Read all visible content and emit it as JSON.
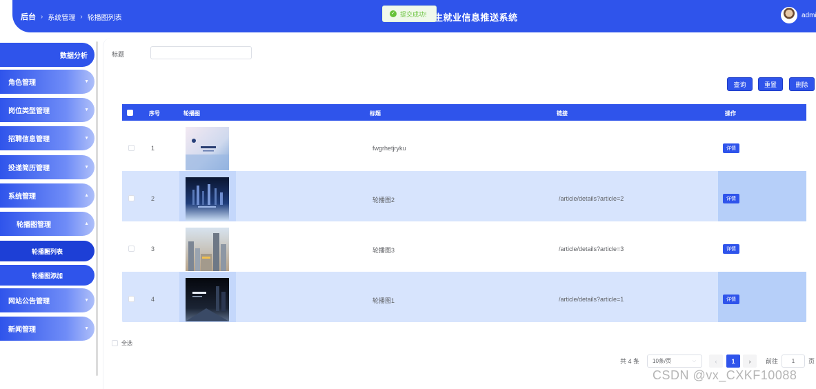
{
  "header": {
    "breadcrumb": [
      "后台",
      "系统管理",
      "轮播图列表"
    ],
    "system_title": "生就业信息推送系统",
    "user": "admi"
  },
  "toast": {
    "text": "提交成功!"
  },
  "sidebar": {
    "items": [
      {
        "label": "数据分析"
      },
      {
        "label": "角色管理"
      },
      {
        "label": "岗位类型管理"
      },
      {
        "label": "招聘信息管理"
      },
      {
        "label": "投递简历管理"
      },
      {
        "label": "系统管理"
      },
      {
        "label": "轮播图管理"
      },
      {
        "label": "轮播图列表"
      },
      {
        "label": "轮播图添加"
      },
      {
        "label": "网站公告管理"
      },
      {
        "label": "新闻管理"
      }
    ]
  },
  "filter": {
    "label": "标题"
  },
  "buttons": {
    "query": "查询",
    "reset": "重置",
    "delete": "删除"
  },
  "table": {
    "columns": [
      "序号",
      "轮播图",
      "标题",
      "链接",
      "操作"
    ],
    "rows": [
      {
        "index": "1",
        "title": "fwgrhetjryku",
        "link": "",
        "action": "详情"
      },
      {
        "index": "2",
        "title": "轮播图2",
        "link": "/article/details?article=2",
        "action": "详情"
      },
      {
        "index": "3",
        "title": "轮播图3",
        "link": "/article/details?article=3",
        "action": "详情"
      },
      {
        "index": "4",
        "title": "轮播图1",
        "link": "/article/details?article=1",
        "action": "详情"
      }
    ]
  },
  "select_all": "全选",
  "pagination": {
    "total": "共 4 条",
    "page_size": "10条/页",
    "current_page": "1",
    "goto_label": "前往",
    "goto_value": "1",
    "page_suffix": "页"
  },
  "watermark": "CSDN @vx_CXKF10088",
  "colors": {
    "primary": "#2f54eb",
    "row_alt": "#d7e4fd",
    "success": "#67c23a"
  }
}
